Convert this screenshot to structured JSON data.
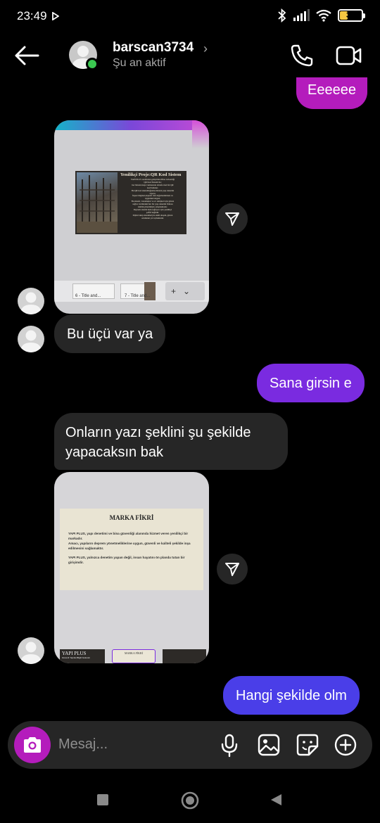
{
  "status_bar": {
    "time": "23:49",
    "battery": "38",
    "battery_level": 0.38
  },
  "header": {
    "username": "barscan3734",
    "chevron": "›",
    "status": "Şu an aktif"
  },
  "messages": {
    "out_top": "Eeeeee",
    "in_1": "Bu üçü var ya",
    "out_2": "Sana girsin e",
    "in_2": "Onların yazı şeklini şu şekilde yapacaksın bak",
    "out_3": "Hangi şekilde olm"
  },
  "image1": {
    "slide_title": "Yenilikçi Proje:QR Kod Sistem",
    "slide_lines": [
      "YAPI PLUS tarafından geliştirilen Bina Güvenliği",
      "QR Kod Sistemi ile;",
      "her binanın kapı vurmasının altında özel bir QR",
      "kod bulunur.",
      "Bu QR kod okutulduğunda,binanın yapı denetim",
      "raporu,",
      "İnşaat bilgileri,deprem risk değerlendirmesi ve",
      "uygunluk belgesi,",
      "Bu sistem, vatandaşlar ve ev sahipleri için güven",
      "sağlar. Göründeki her bir yapı denetim firması",
      "kimlik yönetimiyle çalışmaktadır.",
      "Deprem sistemi hem sağlayıcı için yenilikçi",
      "şeffaf değildir.",
      "Dijital takip sistemleriyle etkili ulaşım, güven",
      "ortamının yol açmaktadır."
    ],
    "thumb_1": "6 - Title and...",
    "thumb_2": "7 - Title and..."
  },
  "image2": {
    "slide_title": "MARKA FİKRİ",
    "para_1": "YAPI PLUS, yapı denetimi ve bina güvenliği alanında hizmet veren yenilikçi bir markadır.",
    "para_2": "Amacı, yapıların deprem yönetmeliklerine uygun, güvenli ve kaliteli şekilde inşa edilmesini sağlamaktır.",
    "para_3": "YAPI PLUS, yalnızca denetim yapan değil, insan hayatını ön planda tutan bir girişimdir.",
    "thumb_a_title": "YAPI PLUS",
    "thumb_a_sub": "Güvenli Yapılar,Bilgili Gelecek",
    "thumb_b_title": "MARKA FİKRİ"
  },
  "composer": {
    "placeholder": "Mesaj..."
  },
  "colors": {
    "bubble_in": "#262626",
    "bubble_out_magenta": "#b41cbc",
    "bubble_out_purple": "#7a2be0",
    "bubble_out_indigo": "#4a3ee8",
    "online": "#3bc851"
  },
  "icons": [
    "back-arrow-icon",
    "phone-icon",
    "video-icon",
    "share-icon",
    "camera-icon",
    "microphone-icon",
    "gallery-icon",
    "sticker-icon",
    "plus-icon",
    "nav-square-icon",
    "nav-circle-icon",
    "nav-triangle-icon"
  ]
}
